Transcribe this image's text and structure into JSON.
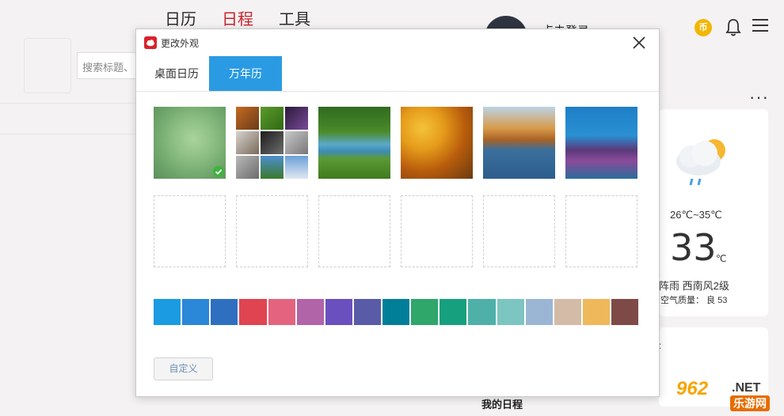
{
  "background": {
    "nav": [
      "日历",
      "日程",
      "工具"
    ],
    "nav_active": 1,
    "username": "点击登录",
    "coin_label": "币",
    "search_placeholder": "搜索标题、",
    "more_dots": "···",
    "weather": {
      "temp_range": "26℃~35℃",
      "temp_now": "33",
      "temp_unit": "℃",
      "description": "阵雨 西南风2级",
      "aqi": "空气质量： 良 53"
    },
    "my_schedule": "我的日程",
    "watermark": {
      "brand": "962",
      "net": ".NET",
      "sub": "乐游网"
    }
  },
  "modal": {
    "title": "更改外观",
    "tabs": [
      {
        "label": "桌面日历",
        "active": false
      },
      {
        "label": "万年历",
        "active": true
      }
    ],
    "themes": [
      {
        "name": "blur-green",
        "selected": true
      },
      {
        "name": "photo-collage",
        "selected": false
      },
      {
        "name": "green-stream",
        "selected": false
      },
      {
        "name": "autumn-leaves",
        "selected": false
      },
      {
        "name": "autumn-river",
        "selected": false
      },
      {
        "name": "coral-reef",
        "selected": false
      }
    ],
    "empty_slots": 6,
    "colors": [
      "#1a9be2",
      "#2b87d8",
      "#2f6fbf",
      "#e04451",
      "#e4637f",
      "#b264a8",
      "#6a4fbf",
      "#5a5ba6",
      "#027f98",
      "#2fa76a",
      "#17a07d",
      "#4fb0aa",
      "#7cc5c1",
      "#9bb6d4",
      "#d4bba8",
      "#efb85b",
      "#7e4a47"
    ],
    "custom_button": "自定义"
  }
}
